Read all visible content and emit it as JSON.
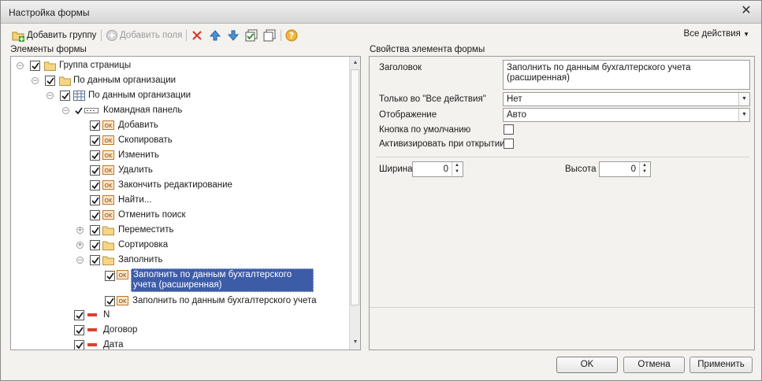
{
  "window": {
    "title": "Настройка формы"
  },
  "toolbar": {
    "add_group": "Добавить группу",
    "add_field": "Добавить поля",
    "all_actions": "Все действия"
  },
  "left": {
    "label": "Элементы формы",
    "tree": [
      {
        "label": "Группа страницы"
      },
      {
        "label": "По данным организации"
      },
      {
        "label": "По данным организации"
      },
      {
        "label": "Командная панель"
      },
      {
        "label": "Добавить"
      },
      {
        "label": "Скопировать"
      },
      {
        "label": "Изменить"
      },
      {
        "label": "Удалить"
      },
      {
        "label": "Закончить редактирование"
      },
      {
        "label": "Найти..."
      },
      {
        "label": "Отменить поиск"
      },
      {
        "label": "Переместить"
      },
      {
        "label": "Сортировка"
      },
      {
        "label": "Заполнить"
      },
      {
        "label": "Заполнить по данным бухгалтерского учета (расширенная)"
      },
      {
        "label": "Заполнить по данным бухгалтерского учета"
      },
      {
        "label": "N"
      },
      {
        "label": "Договор"
      },
      {
        "label": "Дата"
      }
    ]
  },
  "right": {
    "label": "Свойства элемента формы",
    "header_label": "Заголовок",
    "header_value": "Заполнить по данным бухгалтерского учета (расширенная)",
    "only_all_actions_label": "Только во \"Все действия\"",
    "only_all_actions_value": "Нет",
    "display_label": "Отображение",
    "display_value": "Авто",
    "default_button_label": "Кнопка по умолчанию",
    "activate_label": "Активизировать при открытии",
    "width_label": "Ширина",
    "width_value": "0",
    "height_label": "Высота",
    "height_value": "0"
  },
  "buttons": {
    "ok": "OK",
    "cancel": "Отмена",
    "apply": "Применить"
  }
}
